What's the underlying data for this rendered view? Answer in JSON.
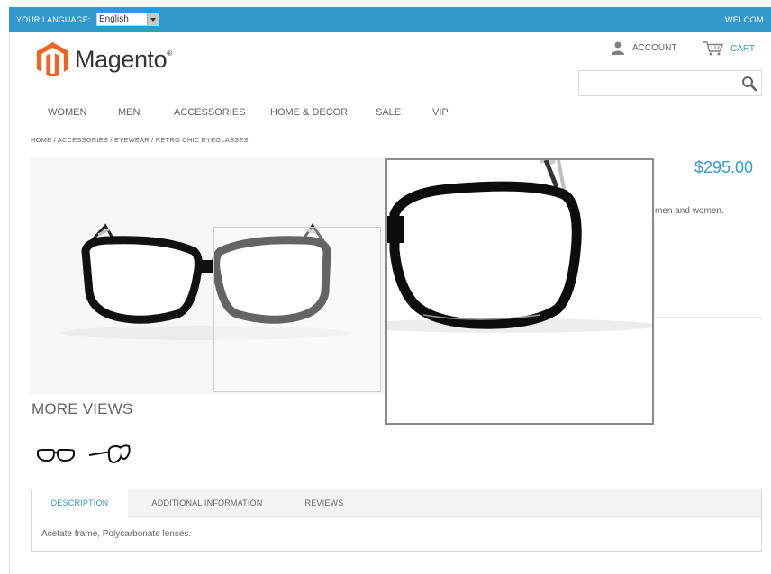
{
  "topbar": {
    "language_label": "YOUR LANGUAGE:",
    "language_value": "English",
    "welcome": "WELCOM"
  },
  "header": {
    "logo_text": "Magento",
    "logo_mark": "®",
    "account_label": "ACCOUNT",
    "cart_label": "CART",
    "search_placeholder": ""
  },
  "nav": {
    "items": [
      "WOMEN",
      "MEN",
      "ACCESSORIES",
      "HOME & DECOR",
      "SALE",
      "VIP"
    ]
  },
  "breadcrumb": "HOME / ACCESSORIES / EYEWEAR / RETRO CHIC EYEGLASSES",
  "product": {
    "price": "$295.00",
    "short_description": "men and women."
  },
  "more_views": {
    "title": "MORE VIEWS",
    "thumbnails": [
      "glasses-front-thumbnail",
      "glasses-side-thumbnail"
    ]
  },
  "tabs": {
    "items": [
      "DESCRIPTION",
      "ADDITIONAL INFORMATION",
      "REVIEWS"
    ],
    "active_index": 0,
    "description_content": "Acetate frame, Polycarbonate lenses."
  },
  "colors": {
    "accent": "#3399cc",
    "logo_orange": "#f26322",
    "text": "#636363"
  },
  "icons": {
    "account": "user-icon",
    "cart": "cart-icon",
    "search": "magnifier-icon",
    "select_arrow": "chevron-down-icon"
  }
}
